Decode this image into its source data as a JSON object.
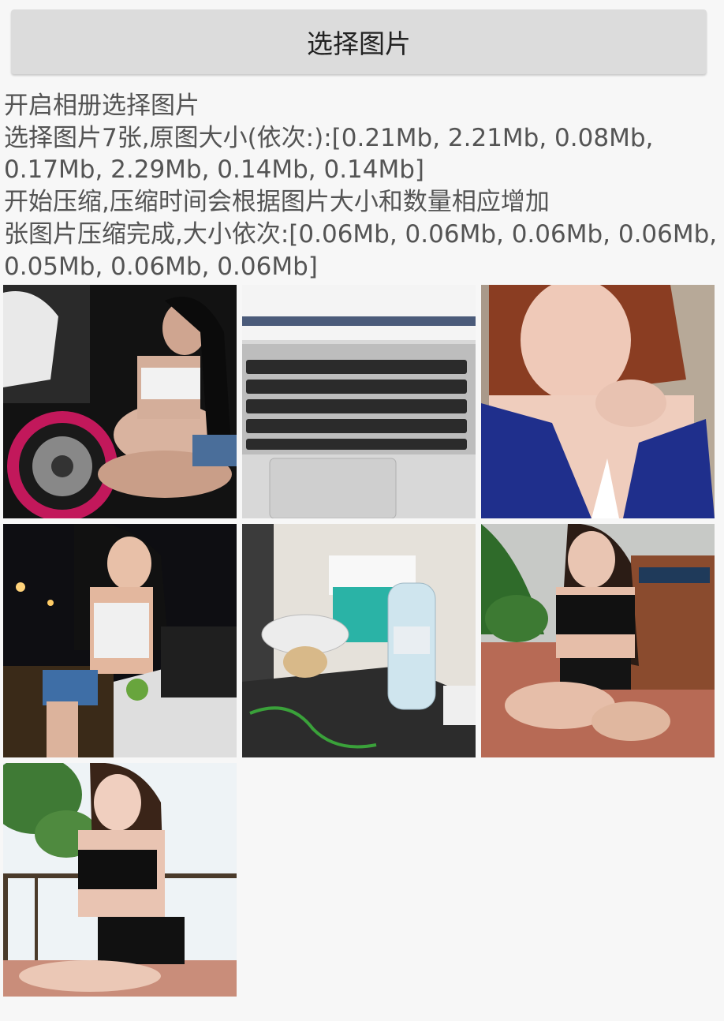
{
  "actions": {
    "select_button_label": "选择图片"
  },
  "log": {
    "lines": [
      "开启相册选择图片",
      "选择图片7张,原图大小(依次:):[0.21Mb, 2.21Mb, 0.08Mb, 0.17Mb, 2.29Mb, 0.14Mb, 0.14Mb]",
      "开始压缩,压缩时间会根据图片大小和数量相应增加",
      "张图片压缩完成,大小依次:[0.06Mb, 0.06Mb, 0.06Mb, 0.06Mb, 0.05Mb, 0.06Mb, 0.06Mb]"
    ]
  },
  "images": [
    {
      "name": "photo-1",
      "subject": "woman-with-motorcycle"
    },
    {
      "name": "photo-2",
      "subject": "laptop-keyboard"
    },
    {
      "name": "photo-3",
      "subject": "woman-blue-top"
    },
    {
      "name": "photo-4",
      "subject": "woman-on-motorbike-night"
    },
    {
      "name": "photo-5",
      "subject": "desk-with-bottle"
    },
    {
      "name": "photo-6",
      "subject": "woman-on-terrace"
    },
    {
      "name": "photo-7",
      "subject": "woman-by-railing"
    }
  ],
  "colors": {
    "background": "#f7f7f7",
    "button_bg": "#dcdcdc",
    "log_text": "#545454"
  }
}
